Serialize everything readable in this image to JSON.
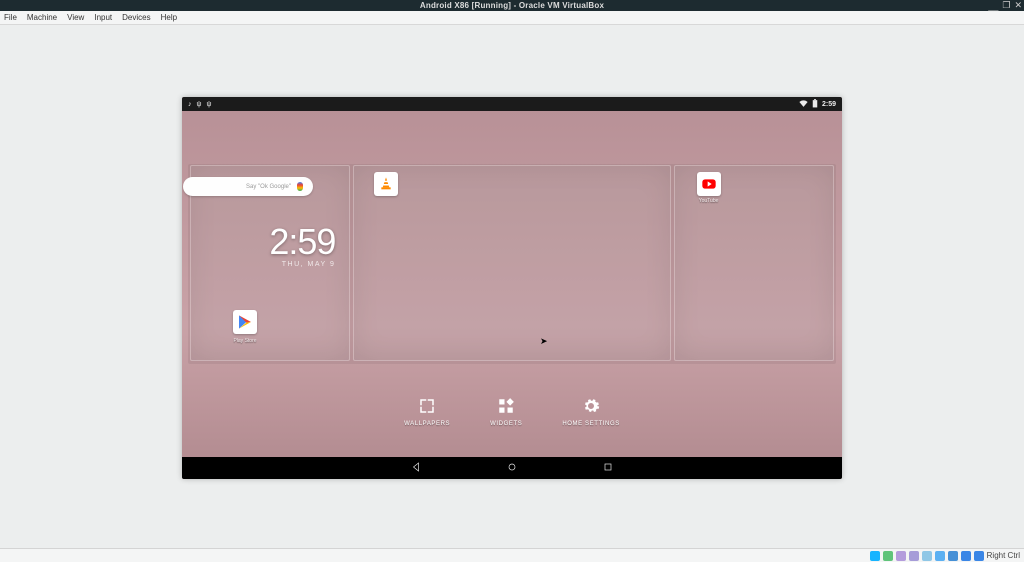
{
  "window": {
    "title": "Android X86 [Running] - Oracle VM VirtualBox",
    "controls": {
      "min": "__",
      "max": "❐",
      "close": "✕"
    }
  },
  "menubar": {
    "items": [
      "File",
      "Machine",
      "View",
      "Input",
      "Devices",
      "Help"
    ]
  },
  "android": {
    "status": {
      "left_icons": [
        "♪",
        "ψ",
        "ψ"
      ],
      "wifi": "▾",
      "battery": "▮",
      "time": "2:59"
    },
    "search": {
      "placeholder": "Say \"Ok Google\""
    },
    "clock": {
      "time": "2:59",
      "date": "THU, MAY 9"
    },
    "apps": {
      "play": {
        "label": "Play Store"
      },
      "vlc": {
        "label": "VLC"
      },
      "youtube": {
        "label": "YouTube"
      }
    },
    "bottom": {
      "wallpapers": "WALLPAPERS",
      "widgets": "WIDGETS",
      "settings": "HOME SETTINGS"
    }
  },
  "vb_status": {
    "host_key": "Right Ctrl"
  }
}
